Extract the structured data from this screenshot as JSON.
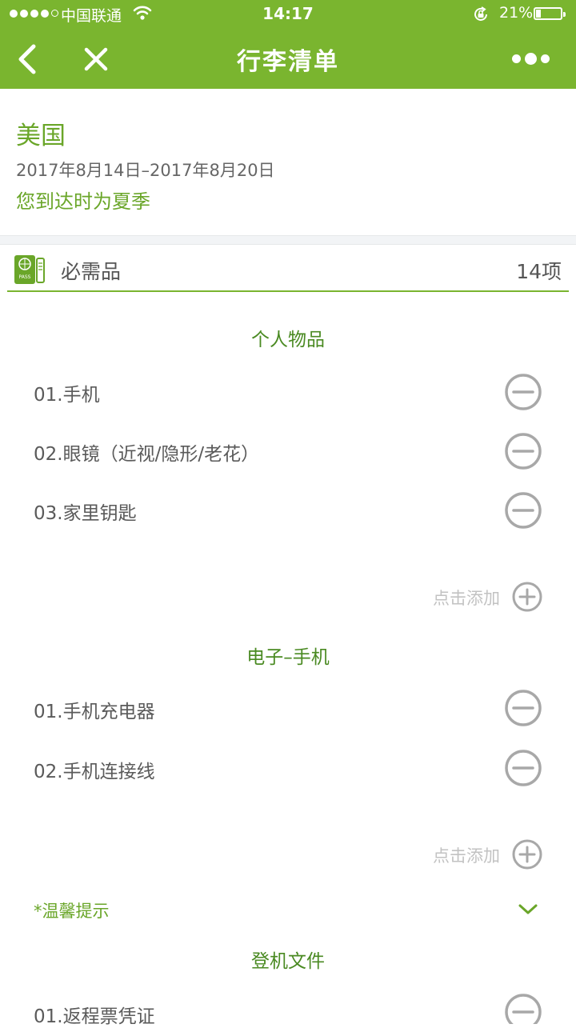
{
  "status_bar": {
    "carrier": "中国联通",
    "time": "14:17",
    "battery": "21%",
    "battery_level": 0.21
  },
  "nav": {
    "title": "行李清单",
    "back_icon": "chevron-left-icon",
    "close_icon": "close-icon",
    "more_icon": "more-dots-icon"
  },
  "destination": {
    "name": "美国",
    "dates": "2017年8月14日–2017年8月20日",
    "season_note": "您到达时为夏季"
  },
  "category": {
    "icon": "passport-icon",
    "icon_text": "PASS",
    "name": "必需品",
    "count": "14项"
  },
  "groups": [
    {
      "title": "个人物品",
      "items": [
        "01.手机",
        "02.眼镜（近视/隐形/老花）",
        "03.家里钥匙"
      ],
      "add_label": "点击添加"
    },
    {
      "title": "电子–手机",
      "items": [
        "01.手机充电器",
        "02.手机连接线"
      ],
      "add_label": "点击添加",
      "tip_label": "*温馨提示"
    },
    {
      "title": "登机文件",
      "items": [
        "01.返程票凭证"
      ]
    }
  ],
  "colors": {
    "brand_green": "#7ab52f",
    "text_green": "#6aa629",
    "icon_gray": "#a8a8a8"
  }
}
